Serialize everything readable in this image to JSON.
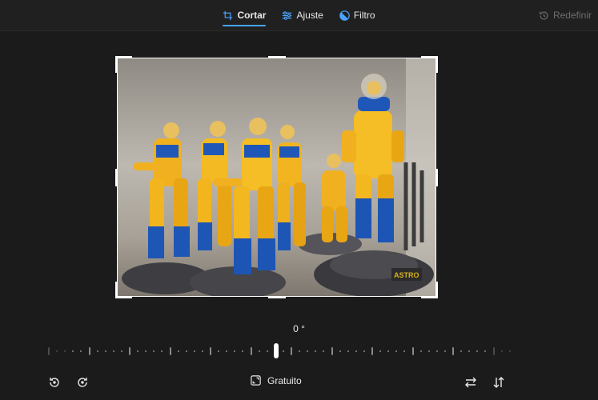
{
  "tabs": [
    {
      "label": "Cortar",
      "icon": "crop-icon",
      "active": true
    },
    {
      "label": "Ajuste",
      "icon": "sliders-icon",
      "active": false
    },
    {
      "label": "Filtro",
      "icon": "filter-icon",
      "active": false
    }
  ],
  "reset": {
    "label": "Redefinir",
    "icon": "history-icon"
  },
  "image": {
    "description_icon": "photo"
  },
  "rotation": {
    "angle_label": "0 °"
  },
  "bottom": {
    "rotate_left_icon": "rotate-left-icon",
    "rotate_right_icon": "rotate-right-icon",
    "aspect_label": "Gratuito",
    "aspect_icon": "aspect-ratio-icon",
    "flip_horizontal_icon": "flip-horizontal-icon",
    "flip_vertical_icon": "flip-vertical-icon"
  },
  "colors": {
    "accent": "#4aa3ff",
    "background": "#1b1b1b",
    "topbar": "#202020"
  }
}
